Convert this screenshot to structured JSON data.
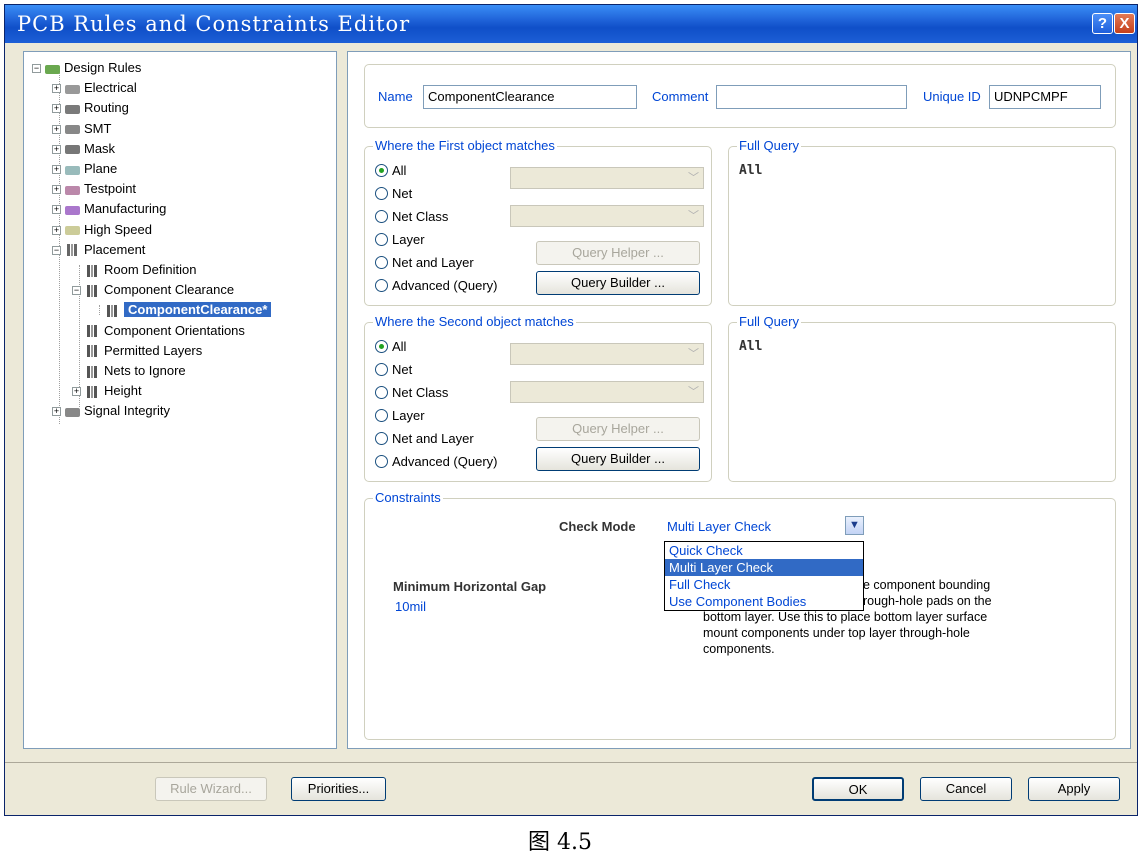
{
  "window": {
    "title": "PCB Rules and Constraints Editor",
    "help_btn": "?",
    "close_btn": "X"
  },
  "tree": [
    {
      "label": "Design Rules",
      "icon": "design-rules-icon",
      "exp": "−"
    },
    {
      "label": "Electrical",
      "icon": "electrical-icon",
      "exp": "+"
    },
    {
      "label": "Routing",
      "icon": "routing-icon",
      "exp": "+"
    },
    {
      "label": "SMT",
      "icon": "smt-icon",
      "exp": "+"
    },
    {
      "label": "Mask",
      "icon": "mask-icon",
      "exp": "+"
    },
    {
      "label": "Plane",
      "icon": "plane-icon",
      "exp": "+"
    },
    {
      "label": "Testpoint",
      "icon": "testpoint-icon",
      "exp": "+"
    },
    {
      "label": "Manufacturing",
      "icon": "manufacturing-icon",
      "exp": "+"
    },
    {
      "label": "High Speed",
      "icon": "high-speed-icon",
      "exp": "+"
    },
    {
      "label": "Placement",
      "icon": "placement-icon",
      "exp": "−"
    },
    {
      "label": "Room Definition",
      "icon": "rule-icon"
    },
    {
      "label": "Component Clearance",
      "icon": "rule-icon",
      "exp": "−"
    },
    {
      "label": "ComponentClearance*",
      "icon": "rule-icon"
    },
    {
      "label": "Component Orientations",
      "icon": "rule-icon"
    },
    {
      "label": "Permitted Layers",
      "icon": "rule-icon"
    },
    {
      "label": "Nets to Ignore",
      "icon": "rule-icon"
    },
    {
      "label": "Height",
      "icon": "rule-icon",
      "exp": "+"
    },
    {
      "label": "Signal Integrity",
      "icon": "signal-integrity-icon",
      "exp": "+"
    }
  ],
  "rule": {
    "name_label": "Name",
    "name_value": "ComponentClearance",
    "comment_label": "Comment",
    "comment_value": "",
    "uid_label": "Unique ID",
    "uid_value": "UDNPCMPF"
  },
  "first": {
    "title": "Where the First object matches",
    "options": [
      "All",
      "Net",
      "Net Class",
      "Layer",
      "Net and Layer",
      "Advanced (Query)"
    ],
    "selected": "All",
    "query_helper": "Query Helper ...",
    "query_builder": "Query Builder ...",
    "full_query_title": "Full Query",
    "full_query": "All"
  },
  "second": {
    "title": "Where the Second object matches",
    "options": [
      "All",
      "Net",
      "Net Class",
      "Layer",
      "Net and Layer",
      "Advanced (Query)"
    ],
    "selected": "All",
    "query_helper": "Query Helper ...",
    "query_builder": "Query Builder ...",
    "full_query_title": "Full Query",
    "full_query": "All"
  },
  "constraints": {
    "title": "Constraints",
    "check_mode_label": "Check Mode",
    "check_mode_value": "Multi Layer Check",
    "dropdown_options": [
      "Quick Check",
      "Multi Layer Check",
      "Full Check",
      "Use Component Bodies"
    ],
    "dropdown_selected": "Multi Layer Check",
    "gap_label": "Minimum Horizontal Gap",
    "gap_value": "10mil",
    "desc_lines": [
      "e component bounding",
      "rough-hole pads on the",
      "bottom layer. Use this to place bottom layer surface",
      "mount components under top layer through-hole",
      "components."
    ]
  },
  "footer": {
    "rule_wizard": "Rule Wizard...",
    "priorities": "Priorities...",
    "ok": "OK",
    "cancel": "Cancel",
    "apply": "Apply"
  },
  "caption": "图 4.5"
}
